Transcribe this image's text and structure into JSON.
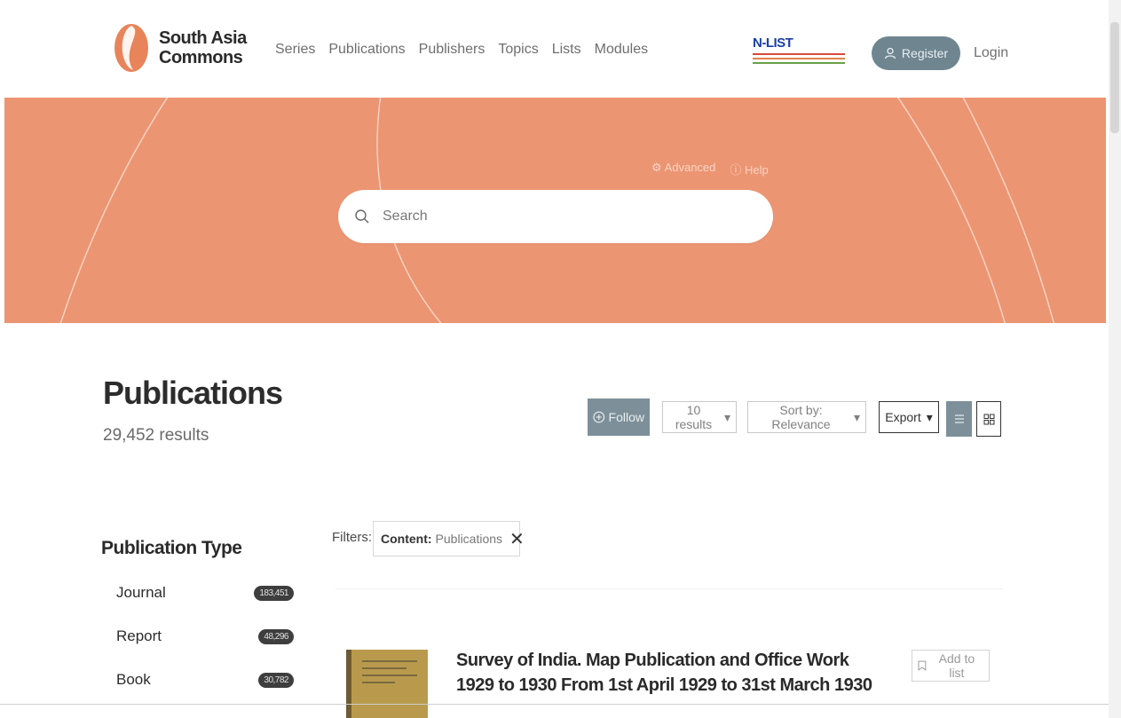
{
  "brand": {
    "name_line1": "South Asia",
    "name_line2": "Commons"
  },
  "nav": {
    "items": [
      "Series",
      "Publications",
      "Publishers",
      "Topics",
      "Lists",
      "Modules"
    ]
  },
  "partner": {
    "title": "N-LIST"
  },
  "header": {
    "register_label": "Register",
    "login_label": "Login"
  },
  "hero": {
    "advanced_label": "Advanced",
    "help_label": "Help",
    "search_placeholder": "Search"
  },
  "page": {
    "title": "Publications",
    "results_count": "29,452 results"
  },
  "toolbar": {
    "follow_label": "Follow",
    "per_page_label": "10 results",
    "sort_label": "Sort by: Relevance",
    "export_label": "Export"
  },
  "facets": {
    "title": "Publication Type",
    "items": [
      {
        "label": "Journal",
        "count": "183,451"
      },
      {
        "label": "Report",
        "count": "48,296"
      },
      {
        "label": "Book",
        "count": "30,782"
      }
    ]
  },
  "filters": {
    "label": "Filters:",
    "chip_key": "Content:",
    "chip_value": "Publications"
  },
  "results": [
    {
      "title_line1": "Survey of India. Map Publication and Office Work",
      "title_line2": "1929 to 1930 From 1st April 1929 to 31st March 1930",
      "add_label": "Add to list"
    }
  ],
  "colors": {
    "hero": "#ec9572",
    "accent_slate": "#7d9099",
    "brand_orange": "#e8845a"
  }
}
